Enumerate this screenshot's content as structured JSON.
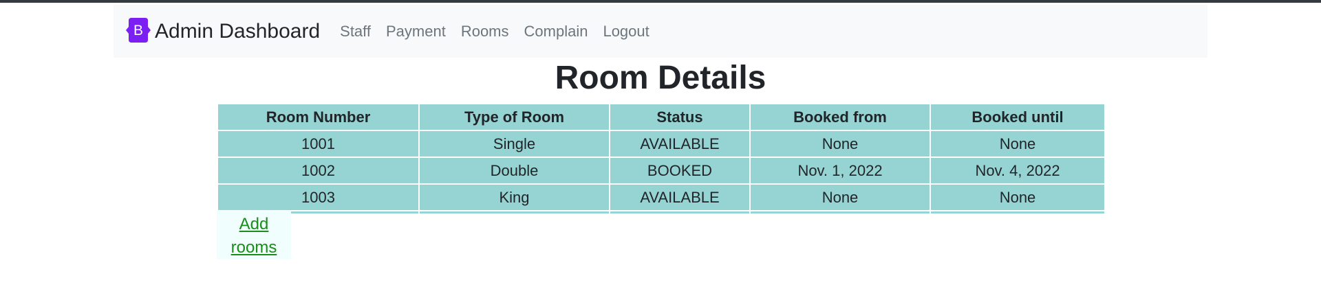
{
  "app": {
    "brand_initial": "B",
    "title": "Admin Dashboard",
    "colors": {
      "brand": "#7b1ff2",
      "table_cell": "#96d4d4",
      "link": "#198c19",
      "nav_bg": "#f8f9fa",
      "nav_link": "#6c757d"
    }
  },
  "nav": {
    "items": [
      {
        "label": "Staff"
      },
      {
        "label": "Payment"
      },
      {
        "label": "Rooms"
      },
      {
        "label": "Complain"
      },
      {
        "label": "Logout"
      }
    ]
  },
  "main": {
    "title": "Room Details",
    "table": {
      "headers": [
        "Room Number",
        "Type of Room",
        "Status",
        "Booked from",
        "Booked until"
      ],
      "rows": [
        [
          "1001",
          "Single",
          "AVAILABLE",
          "None",
          "None"
        ],
        [
          "1002",
          "Double",
          "BOOKED",
          "Nov. 1, 2022",
          "Nov. 4, 2022"
        ],
        [
          "1003",
          "King",
          "AVAILABLE",
          "None",
          "None"
        ]
      ]
    },
    "add_link": {
      "line1": "Add",
      "line2": "rooms"
    }
  }
}
